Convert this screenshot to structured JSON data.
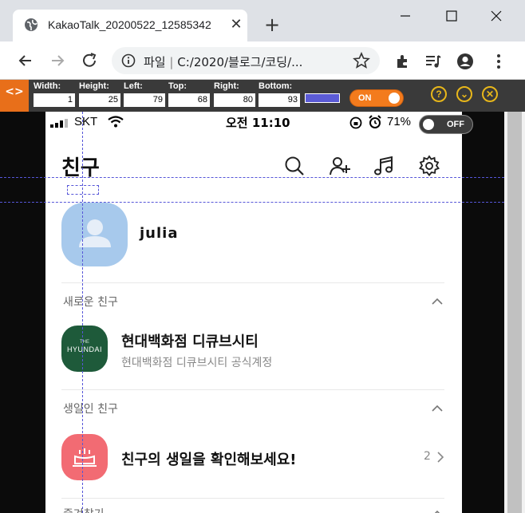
{
  "browser": {
    "tab_title": "KakaoTalk_20200522_12585342",
    "new_tab": "+",
    "close_tab": "✕",
    "address_prefix": "파일",
    "address_sep": "|",
    "address_path": "C:/2020/블로그/코딩/..."
  },
  "measure": {
    "logo": "<>",
    "fields": [
      {
        "label": "Width:",
        "value": "1"
      },
      {
        "label": "Height:",
        "value": "25"
      },
      {
        "label": "Left:",
        "value": "79"
      },
      {
        "label": "Top:",
        "value": "68"
      },
      {
        "label": "Right:",
        "value": "80"
      },
      {
        "label": "Bottom:",
        "value": "93"
      }
    ],
    "guide_color": "#5b5bd6",
    "toggle_on_label": "ON",
    "toggle_off_label": "OFF",
    "help": "?",
    "collapse": "⌄",
    "close": "✕"
  },
  "phone": {
    "status": {
      "carrier": "SKT",
      "time": "오전 11:10",
      "battery": "71%"
    },
    "header": {
      "title": "친구"
    },
    "profile": {
      "name": "julia"
    },
    "sections": [
      {
        "title": "새로운 친구"
      },
      {
        "title": "생일인 친구"
      },
      {
        "title": "즐겨찾기"
      }
    ],
    "new_friend": {
      "logo_small": "THE",
      "logo_text": "HYUNDAI",
      "name": "현대백화점 디큐브시티",
      "sub": "현대백화점 디큐브시티 공식계정"
    },
    "birthday": {
      "text": "친구의 생일을 확인해보세요!",
      "count": "2"
    }
  }
}
